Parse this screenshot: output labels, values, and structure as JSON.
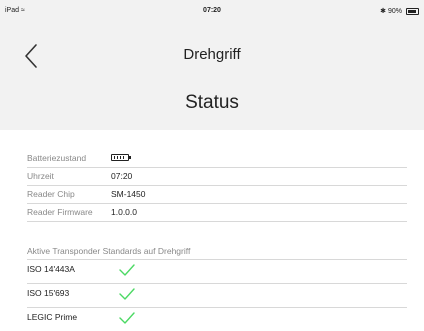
{
  "status_bar": {
    "device": "iPad",
    "time": "07:20",
    "battery": "90%"
  },
  "header": {
    "back_icon": "chevron-left-icon",
    "title": "Drehgriff",
    "page_title": "Status"
  },
  "info": {
    "battery_label": "Batteriezustand",
    "battery_icon": "battery-icon",
    "time_label": "Uhrzeit",
    "time_value": "07:20",
    "chip_label": "Reader Chip",
    "chip_value": "SM-1450",
    "firmware_label": "Reader Firmware",
    "firmware_value": "1.0.0.0"
  },
  "transponders": {
    "section_title": "Aktive Transponder Standards auf Drehgriff",
    "check_icon": "checkmark-icon",
    "check_color": "#4cd964",
    "items": [
      {
        "label": "ISO 14'443A"
      },
      {
        "label": "ISO 15'693"
      },
      {
        "label": "LEGIC Prime"
      }
    ]
  }
}
